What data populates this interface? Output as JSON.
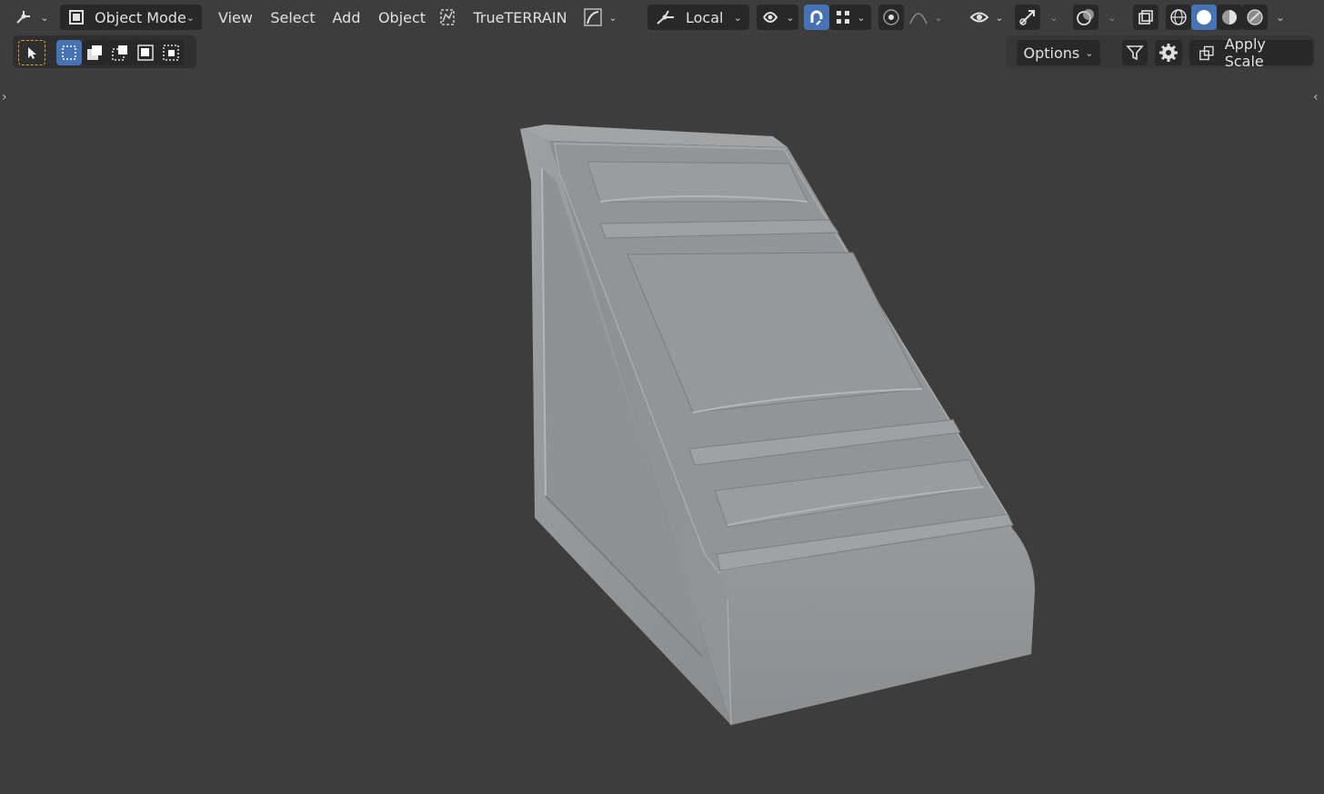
{
  "header": {
    "mode": {
      "label": "Object Mode"
    },
    "menus": [
      {
        "label": "View"
      },
      {
        "label": "Select"
      },
      {
        "label": "Add"
      },
      {
        "label": "Object"
      }
    ],
    "addon_label": "TrueTERRAIN",
    "transform_orientation": "Local"
  },
  "toolbar": {
    "options_label": "Options",
    "apply_scale_label": "Apply Scale"
  },
  "colors": {
    "accent": "#4772b3",
    "background": "#3d3d3d",
    "panel": "#282828",
    "model": "#8e9092"
  }
}
